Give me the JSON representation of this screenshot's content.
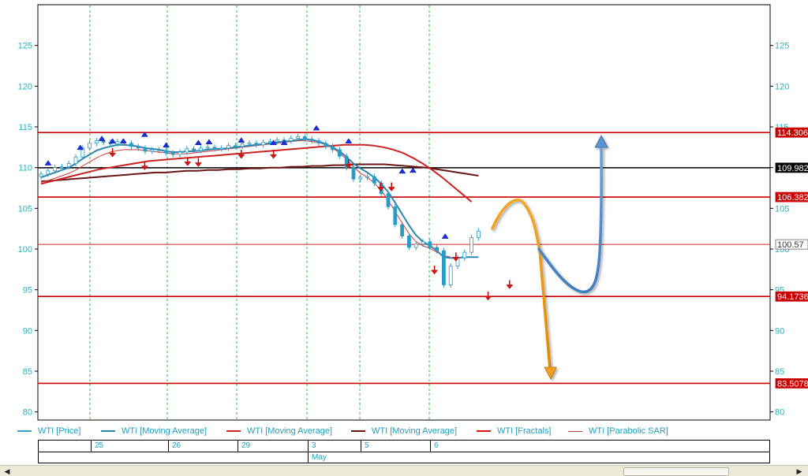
{
  "chart_data": {
    "type": "candlestick",
    "instrument": "WTI",
    "y_axis": {
      "ylim": [
        79,
        130
      ],
      "ticks": [
        80,
        85,
        90,
        95,
        100,
        105,
        110,
        115,
        120,
        125
      ],
      "grid": false
    },
    "x_axis": {
      "date_labels": [
        "25",
        "26",
        "29",
        "3",
        "5",
        "6"
      ],
      "month_label": "May"
    },
    "legend": [
      {
        "label": "WTI [Price]",
        "color": "#3aa0c8"
      },
      {
        "label": "WTI [Moving Average]",
        "color": "#2e86b0"
      },
      {
        "label": "WTI [Moving Average]",
        "color": "#cc2222"
      },
      {
        "label": "WTI [Moving Average]",
        "color": "#6b1515"
      },
      {
        "label": "WTI [Fractals]",
        "color": "#dd1111"
      },
      {
        "label": "WTI [Parabolic SAR]",
        "color": "#bb4444"
      }
    ],
    "horizontal_levels": [
      {
        "value": 114.3068,
        "label": "114.3068",
        "color": "#cc0000",
        "tag_bg": "#cc0000",
        "tag_fg": "#ffffff"
      },
      {
        "value": 109.9823,
        "label": "109.9823",
        "color": "#000000",
        "tag_bg": "#000000",
        "tag_fg": "#ffffff"
      },
      {
        "value": 106.3821,
        "label": "106.3821",
        "color": "#cc0000",
        "tag_bg": "#cc0000",
        "tag_fg": "#ffffff"
      },
      {
        "value": 100.57,
        "label": "100.57",
        "color": "#cc2222",
        "tag_bg": "#ffffff",
        "tag_fg": "#333333"
      },
      {
        "value": 94.1736,
        "label": "94.1736",
        "color": "#cc0000",
        "tag_bg": "#cc0000",
        "tag_fg": "#ffffff"
      },
      {
        "value": 83.5078,
        "label": "83.5078",
        "color": "#cc0000",
        "tag_bg": "#cc0000",
        "tag_fg": "#ffffff"
      }
    ],
    "series": {
      "close": [
        109.2,
        109.6,
        110.0,
        110.1,
        110.5,
        111.3,
        112.4,
        113.0,
        113.3,
        113.1,
        112.9,
        113.2,
        113.0,
        112.6,
        112.4,
        112.0,
        112.2,
        112.1,
        111.8,
        111.6,
        111.9,
        112.3,
        112.1,
        112.4,
        112.5,
        112.3,
        112.4,
        112.7,
        112.6,
        112.9,
        113.0,
        112.8,
        113.1,
        113.2,
        113.4,
        113.3,
        113.6,
        113.8,
        113.5,
        113.3,
        113.0,
        112.6,
        112.2,
        111.4,
        110.0,
        108.6,
        108.8,
        108.9,
        108.1,
        106.8,
        105.2,
        103.0,
        101.6,
        100.2,
        100.6,
        100.9,
        100.2,
        99.8,
        95.6,
        97.9,
        98.9,
        99.6,
        101.4,
        102.2
      ],
      "ma_fast": [
        108.8,
        109.1,
        109.4,
        109.7,
        110.0,
        110.5,
        111.1,
        111.6,
        112.1,
        112.4,
        112.6,
        112.8,
        112.8,
        112.7,
        112.6,
        112.4,
        112.3,
        112.2,
        112.0,
        111.9,
        111.9,
        112.0,
        112.0,
        112.1,
        112.2,
        112.3,
        112.3,
        112.4,
        112.5,
        112.6,
        112.7,
        112.8,
        112.9,
        113.0,
        113.1,
        113.2,
        113.3,
        113.4,
        113.5,
        113.4,
        113.2,
        112.9,
        112.5,
        112.0,
        111.3,
        110.5,
        109.9,
        109.4,
        108.8,
        108.0,
        107.0,
        105.7,
        104.3,
        102.9,
        101.7,
        100.9,
        100.4,
        99.8,
        99.0,
        98.9,
        98.9,
        99.0,
        99.0,
        99.0
      ],
      "ma_medium": [
        108.2,
        108.4,
        108.7,
        109.0,
        109.3,
        109.7,
        110.2,
        110.7,
        111.2,
        111.6,
        111.9,
        112.1,
        112.2,
        112.2,
        112.2,
        112.1,
        112.0,
        111.9,
        111.8,
        111.7,
        111.7,
        111.7,
        111.8,
        111.9,
        112.0,
        112.1,
        112.2,
        112.3,
        112.4,
        112.5,
        112.6,
        112.7,
        112.8,
        112.9,
        113.0,
        113.1,
        113.2,
        113.3,
        113.3,
        113.2,
        113.1,
        112.8,
        112.4,
        111.8,
        111.0,
        110.1,
        109.3,
        108.8,
        108.1,
        107.2,
        106.0,
        104.6,
        103.2,
        101.9,
        100.9,
        100.4,
        100.1,
        99.6,
        99.2,
        99.0
      ],
      "ma_slow": [
        108.3,
        108.4,
        108.5,
        108.6,
        108.7,
        108.8,
        108.9,
        109.0,
        109.1,
        109.2,
        109.3,
        109.4,
        109.4,
        109.5,
        109.6,
        109.6,
        109.7,
        109.7,
        109.8,
        109.8,
        109.9,
        109.9,
        110.0,
        110.0,
        110.1,
        110.1,
        110.2,
        110.2,
        110.3,
        110.3,
        110.4,
        110.4,
        110.4,
        110.4,
        110.3,
        110.2,
        110.1,
        110.0,
        109.8,
        109.6,
        109.4,
        109.2,
        109.0
      ],
      "ma_red_long": [
        108.0,
        108.3,
        108.6,
        108.9,
        109.2,
        109.5,
        109.8,
        110.0,
        110.2,
        110.4,
        110.6,
        110.8,
        110.9,
        111.0,
        111.1,
        111.2,
        111.3,
        111.4,
        111.5,
        111.6,
        111.7,
        111.8,
        111.9,
        112.0,
        112.1,
        112.2,
        112.3,
        112.4,
        112.5,
        112.6,
        112.7,
        112.8,
        112.8,
        112.8,
        112.7,
        112.5,
        112.2,
        111.8,
        111.2,
        110.5,
        109.7,
        108.8,
        107.8,
        106.8,
        105.8
      ]
    },
    "fractals_up": [
      [
        0,
        110.3
      ],
      [
        3,
        112.2
      ],
      [
        5,
        113.3
      ],
      [
        6,
        113.0
      ],
      [
        7,
        113.0
      ],
      [
        9,
        113.8
      ],
      [
        11,
        112.5
      ],
      [
        14,
        112.8
      ],
      [
        15,
        112.9
      ],
      [
        18,
        113.1
      ],
      [
        21,
        112.8
      ],
      [
        22,
        112.8
      ],
      [
        25,
        114.6
      ],
      [
        28,
        113.0
      ],
      [
        33,
        109.3
      ],
      [
        34,
        109.4
      ],
      [
        37,
        101.3
      ]
    ],
    "fractals_down": [
      [
        6,
        111.8
      ],
      [
        9,
        110.2
      ],
      [
        13,
        110.7
      ],
      [
        14,
        110.6
      ],
      [
        18,
        111.6
      ],
      [
        21,
        111.6
      ],
      [
        28,
        110.4
      ],
      [
        31,
        107.6
      ],
      [
        32,
        107.6
      ],
      [
        36,
        97.4
      ],
      [
        38,
        99.0
      ],
      [
        41,
        94.2
      ],
      [
        43,
        95.6
      ]
    ],
    "forecast_note": "hand-drawn projection arrows"
  }
}
